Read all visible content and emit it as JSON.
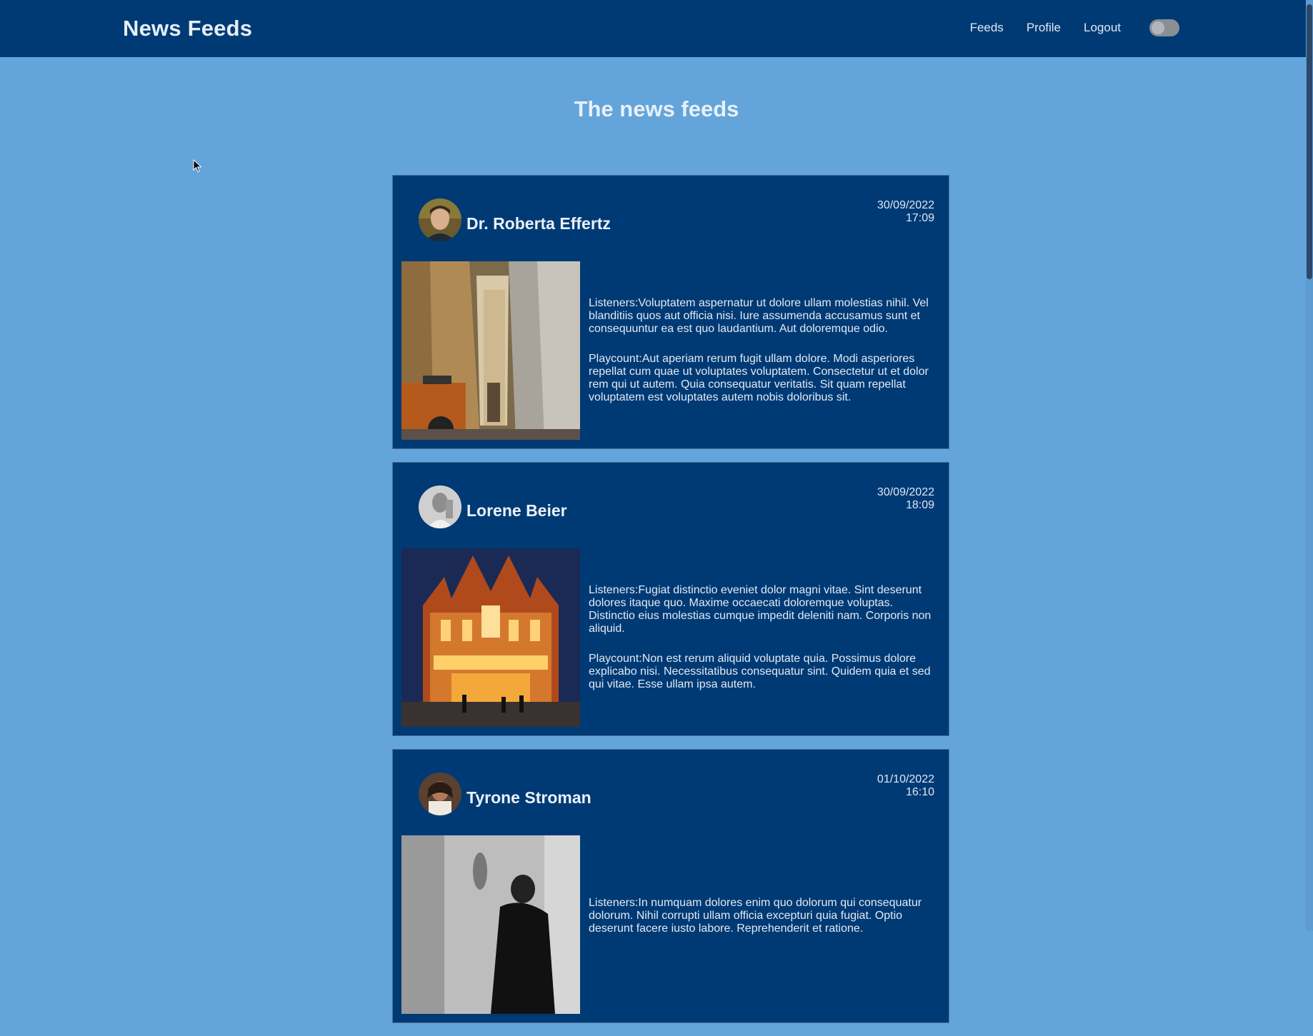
{
  "navbar": {
    "brand": "News Feeds",
    "links": [
      "Feeds",
      "Profile",
      "Logout"
    ],
    "theme_toggle": "off"
  },
  "page": {
    "title": "The news feeds"
  },
  "feeds": [
    {
      "author": "Dr. Roberta Effertz",
      "date": "30/09/2022",
      "time": "17:09",
      "listeners": "Listeners:Voluptatem aspernatur ut dolore ullam molestias nihil. Vel blanditiis quos aut officia nisi. Iure assumenda accusamus sunt et consequuntur ea est quo laudantium. Aut doloremque odio.",
      "playcount": "Playcount:Aut aperiam rerum fugit ullam dolore. Modi asperiores repellat cum quae ut voluptates voluptatem. Consectetur ut et dolor rem qui ut autem. Quia consequatur veritatis. Sit quam repellat voluptatem est voluptates autem nobis doloribus sit."
    },
    {
      "author": "Lorene Beier",
      "date": "30/09/2022",
      "time": "18:09",
      "listeners": "Listeners:Fugiat distinctio eveniet dolor magni vitae. Sint deserunt dolores itaque quo. Maxime occaecati doloremque voluptas. Distinctio eius molestias cumque impedit deleniti nam. Corporis non aliquid.",
      "playcount": "Playcount:Non est rerum aliquid voluptate quia. Possimus dolore explicabo nisi. Necessitatibus consequatur sint. Quidem quia et sed qui vitae. Esse ullam ipsa autem."
    },
    {
      "author": "Tyrone Stroman",
      "date": "01/10/2022",
      "time": "16:10",
      "listeners": "Listeners:In numquam dolores enim quo dolorum qui consequatur dolorum. Nihil corrupti ullam officia excepturi quia fugiat. Optio deserunt facere iusto labore. Reprehenderit et ratione.",
      "playcount": ""
    }
  ],
  "colors": {
    "navbar_bg": "#003a75",
    "page_bg": "#63a4db",
    "card_bg": "#003a75"
  }
}
